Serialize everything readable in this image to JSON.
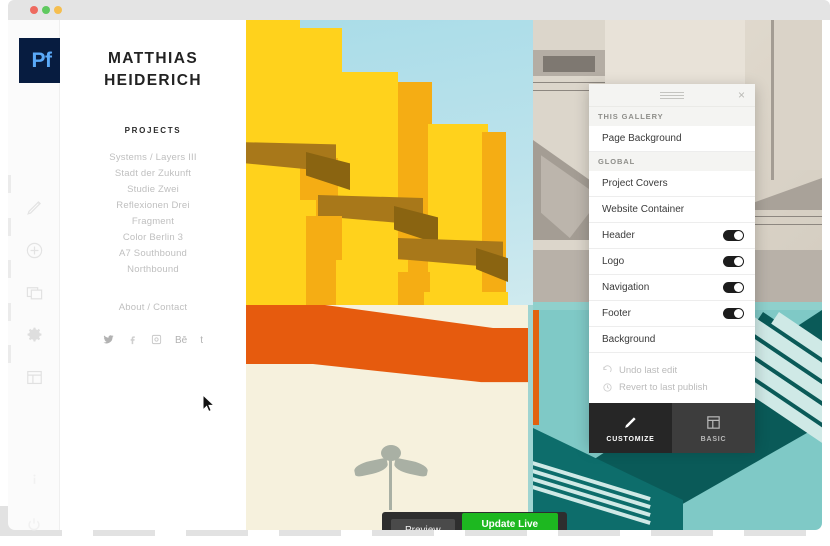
{
  "window": {
    "dots": [
      {
        "name": "close-dot",
        "color": "#ee6a5f"
      },
      {
        "name": "minimize-dot",
        "color": "#5fc95f"
      },
      {
        "name": "maximize-dot",
        "color": "#f5be4f"
      }
    ]
  },
  "left_rail": {
    "logo_text": "Pf",
    "logo_bg": "#071c40",
    "logo_color": "#5aa9f8",
    "tools": [
      {
        "name": "edit-pencil-icon",
        "label": "Edit"
      },
      {
        "name": "add-circle-icon",
        "label": "Add"
      },
      {
        "name": "layers-icon",
        "label": "Pages"
      },
      {
        "name": "gear-icon",
        "label": "Settings"
      },
      {
        "name": "layout-icon",
        "label": "Layout"
      }
    ],
    "footer_tools": [
      {
        "name": "info-icon",
        "label": "Info"
      },
      {
        "name": "power-icon",
        "label": "Power"
      }
    ]
  },
  "site": {
    "title_line1": "MATTHIAS",
    "title_line2": "HEIDERICH",
    "projects_heading": "PROJECTS",
    "projects": [
      "Systems / Layers III",
      "Stadt der Zukunft",
      "Studie Zwei",
      "Reflexionen Drei",
      "Fragment",
      "Color Berlin 3",
      "A7 Southbound",
      "Northbound"
    ],
    "about_link": "About / Contact",
    "social": [
      {
        "name": "twitter-icon",
        "glyph": "❖",
        "label": "Twitter"
      },
      {
        "name": "facebook-icon",
        "glyph": "f",
        "label": "Facebook"
      },
      {
        "name": "instagram-icon",
        "glyph": "▣",
        "label": "Instagram"
      },
      {
        "name": "behance-icon",
        "glyph": "Bē",
        "label": "Behance"
      },
      {
        "name": "tumblr-icon",
        "glyph": "t",
        "label": "Tumblr"
      }
    ],
    "gallery": [
      {
        "name": "gallery-image-yellow-cubes",
        "alt": "Yellow cubic architecture against blue sky"
      },
      {
        "name": "gallery-image-beige-modern",
        "alt": "Beige modernist concrete building"
      },
      {
        "name": "gallery-image-orange-band",
        "alt": "Orange diagonal band on cream wall"
      },
      {
        "name": "gallery-image-teal-stripes",
        "alt": "Teal striped diagonal facade"
      }
    ]
  },
  "publish_bar": {
    "preview_label": "Preview",
    "update_label": "Update Live Site",
    "update_color": "#1db820"
  },
  "panel": {
    "close_glyph": "×",
    "sections": [
      {
        "heading": "THIS GALLERY",
        "rows": [
          {
            "label": "Page Background",
            "toggle": null
          }
        ]
      },
      {
        "heading": "GLOBAL",
        "rows": [
          {
            "label": "Project Covers",
            "toggle": null
          },
          {
            "label": "Website Container",
            "toggle": null
          },
          {
            "label": "Header",
            "toggle": "on"
          },
          {
            "label": "Logo",
            "toggle": "on"
          },
          {
            "label": "Navigation",
            "toggle": "on"
          },
          {
            "label": "Footer",
            "toggle": "on"
          },
          {
            "label": "Background",
            "toggle": null
          }
        ]
      }
    ],
    "actions": [
      {
        "name": "undo-last-edit-action",
        "label": "Undo last edit",
        "icon": "undo-icon"
      },
      {
        "name": "revert-to-last-publish-action",
        "label": "Revert to last publish",
        "icon": "revert-icon"
      }
    ],
    "tabs": [
      {
        "name": "tab-customize",
        "label": "CUSTOMIZE",
        "icon": "pencil-icon",
        "active": true
      },
      {
        "name": "tab-basic",
        "label": "BASIC",
        "icon": "layout-icon",
        "active": false
      }
    ]
  }
}
